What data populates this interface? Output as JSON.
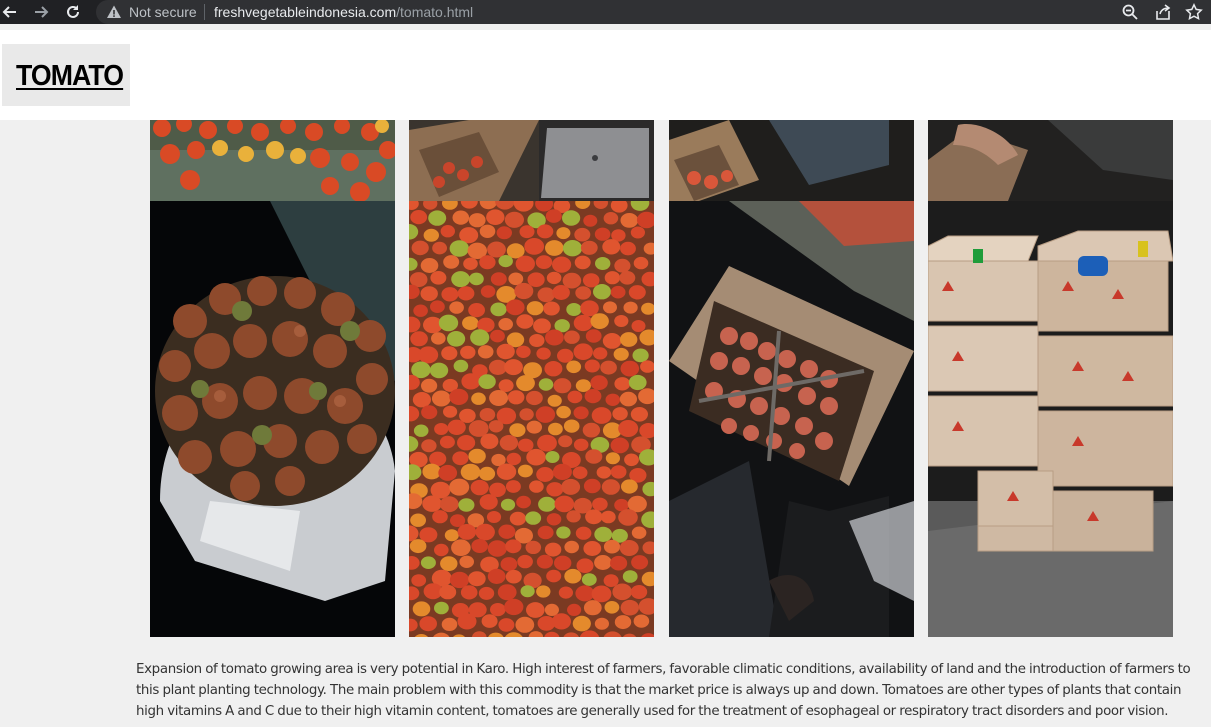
{
  "browser": {
    "security_label": "Not secure",
    "url_domain": "freshvegetableindonesia.com",
    "url_path": "/tomato.html"
  },
  "page": {
    "title": "TOMATO",
    "description": "Expansion of tomato growing area is very potential in Karo. High interest of farmers, favorable climatic conditions, availability of land and the introduction of farmers to this plant planting technology. The main problem with this commodity is that the market price is always up and down. Tomatoes are other types of plants that contain high vitamins A and C due to their high vitamin content, tomatoes are generally used for the treatment of esophageal or respiratory tract disorders and poor vision."
  },
  "icons": {
    "back": "arrow-left-icon",
    "forward": "arrow-right-icon",
    "reload": "reload-icon",
    "warning": "warning-icon",
    "zoom": "zoom-icon",
    "share": "share-icon",
    "bookmark": "star-icon"
  },
  "colors": {
    "page_bg": "#f0f0f0",
    "browser_bar": "#202124",
    "tomato_red": "#d9482a"
  }
}
